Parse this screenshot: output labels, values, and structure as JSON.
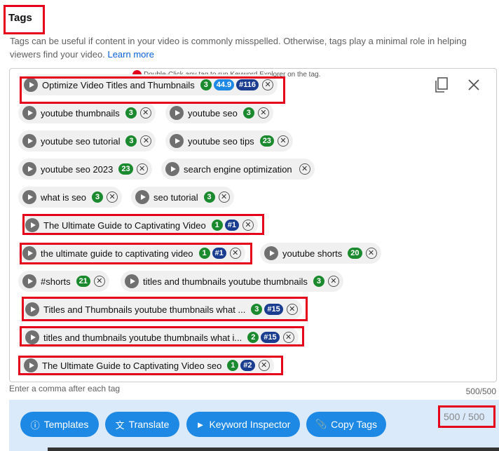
{
  "section": {
    "title": "Tags",
    "description": "Tags can be useful if content in your video is commonly misspelled. Otherwise, tags play a minimal role in helping viewers find your video.",
    "learn_more": "Learn more",
    "hint": "Double-Click any tag to run Keyword Explorer on the tag.",
    "helper": "Enter a comma after each tag",
    "count_small": "500/500"
  },
  "tags": [
    {
      "text": "Optimize Video Titles and Thumbnails",
      "badges": [
        {
          "v": "3",
          "c": "green"
        },
        {
          "v": "44.9",
          "c": "blue"
        },
        {
          "v": "#116",
          "c": "navy"
        }
      ]
    },
    {
      "text": "youtube thumbnails",
      "badges": [
        {
          "v": "3",
          "c": "green"
        }
      ]
    },
    {
      "text": "youtube seo",
      "badges": [
        {
          "v": "3",
          "c": "green"
        }
      ]
    },
    {
      "text": "youtube seo tutorial",
      "badges": [
        {
          "v": "3",
          "c": "green"
        }
      ]
    },
    {
      "text": "youtube seo tips",
      "badges": [
        {
          "v": "23",
          "c": "green"
        }
      ]
    },
    {
      "text": "youtube seo 2023",
      "badges": [
        {
          "v": "23",
          "c": "green"
        }
      ]
    },
    {
      "text": "search engine optimization",
      "badges": []
    },
    {
      "text": "what is seo",
      "badges": [
        {
          "v": "3",
          "c": "green"
        }
      ]
    },
    {
      "text": "seo tutorial",
      "badges": [
        {
          "v": "3",
          "c": "green"
        }
      ]
    },
    {
      "text": "The Ultimate Guide to Captivating Video",
      "badges": [
        {
          "v": "1",
          "c": "green"
        },
        {
          "v": "#1",
          "c": "navy"
        }
      ]
    },
    {
      "text": "the ultimate guide to captivating video",
      "badges": [
        {
          "v": "1",
          "c": "green"
        },
        {
          "v": "#1",
          "c": "navy"
        }
      ]
    },
    {
      "text": "youtube shorts",
      "badges": [
        {
          "v": "20",
          "c": "green"
        }
      ]
    },
    {
      "text": "#shorts",
      "badges": [
        {
          "v": "21",
          "c": "green"
        }
      ]
    },
    {
      "text": "titles and thumbnails youtube thumbnails",
      "badges": [
        {
          "v": "3",
          "c": "green"
        }
      ]
    },
    {
      "text": "Titles and Thumbnails youtube thumbnails what ...",
      "badges": [
        {
          "v": "3",
          "c": "green"
        },
        {
          "v": "#15",
          "c": "navy"
        }
      ]
    },
    {
      "text": "titles and thumbnails youtube thumbnails what i...",
      "badges": [
        {
          "v": "2",
          "c": "green"
        },
        {
          "v": "#15",
          "c": "navy"
        }
      ]
    },
    {
      "text": "The Ultimate Guide to Captivating Video seo",
      "badges": [
        {
          "v": "1",
          "c": "green"
        },
        {
          "v": "#2",
          "c": "navy"
        }
      ]
    }
  ],
  "toolbar": {
    "templates": "Templates",
    "translate": "Translate",
    "keyword_inspector": "Keyword Inspector",
    "copy_tags": "Copy Tags",
    "count": "500 / 500"
  },
  "colors": {
    "green": "#1b8a2e",
    "blue": "#1e88e5",
    "navy": "#1a3d8f",
    "highlight": "#e4001b"
  }
}
